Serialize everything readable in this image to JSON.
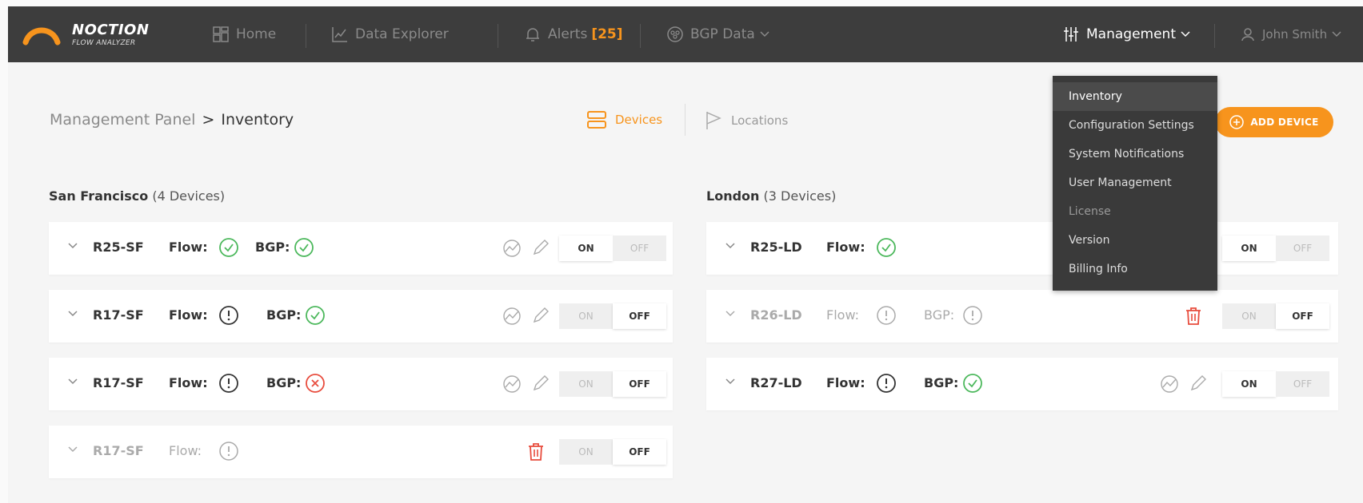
{
  "nav": {
    "brand_line1": "NOCTION",
    "brand_line2": "FLOW ANALYZER",
    "home": "Home",
    "data_explorer": "Data Explorer",
    "alerts": "Alerts",
    "alerts_count": "[25]",
    "bgp_data": "BGP Data",
    "management": "Management",
    "user": "John Smith"
  },
  "breadcrumb": {
    "parent": "Management Panel",
    "separator": ">",
    "current": "Inventory"
  },
  "tabs": {
    "devices": "Devices",
    "locations": "Locations"
  },
  "add_device_label": "ADD DEVICE",
  "groups": [
    {
      "name": "San Francisco",
      "count_text": "(4 Devices)",
      "devices": [
        {
          "name": "R25-SF",
          "flow_label": "Flow:",
          "flow_status": "ok",
          "bgp_label": "BGP:",
          "bgp_status": "ok",
          "enabled": true,
          "dim": false
        },
        {
          "name": "R17-SF",
          "flow_label": "Flow:",
          "flow_status": "warn",
          "bgp_label": "BGP:",
          "bgp_status": "ok",
          "enabled": false,
          "dim": false
        },
        {
          "name": "R17-SF",
          "flow_label": "Flow:",
          "flow_status": "warn",
          "bgp_label": "BGP:",
          "bgp_status": "error",
          "enabled": false,
          "dim": false
        },
        {
          "name": "R17-SF",
          "flow_label": "Flow:",
          "flow_status": "warn",
          "enabled": false,
          "dim": true
        }
      ]
    },
    {
      "name": "London",
      "count_text": "(3 Devices)",
      "devices": [
        {
          "name": "R25-LD",
          "flow_label": "Flow:",
          "flow_status": "ok",
          "enabled": true,
          "dim": false
        },
        {
          "name": "R26-LD",
          "flow_label": "Flow:",
          "flow_status": "warn",
          "bgp_label": "BGP:",
          "bgp_status": "warn",
          "enabled": false,
          "dim": true
        },
        {
          "name": "R27-LD",
          "flow_label": "Flow:",
          "flow_status": "warn",
          "bgp_label": "BGP:",
          "bgp_status": "ok",
          "enabled": true,
          "dim": false
        }
      ]
    }
  ],
  "toggle": {
    "on": "ON",
    "off": "OFF"
  },
  "management_menu": [
    "Inventory",
    "Configuration Settings",
    "System Notifications",
    "User Management",
    "License",
    "Version",
    "Billing Info"
  ],
  "colors": {
    "accent": "#f7941d",
    "ok": "#4cb85c",
    "error": "#e84c3d",
    "topbar": "#3d3d3d"
  }
}
